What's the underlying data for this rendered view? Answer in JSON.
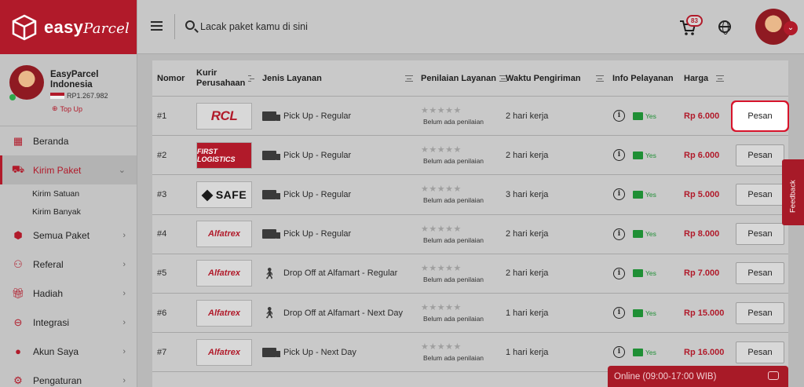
{
  "brand": {
    "name": "easy",
    "name_suffix": "Parcel",
    "color": "#b11a2a"
  },
  "profile": {
    "name": "EasyParcel Indonesia",
    "balance": "RP1.267.982",
    "topup_label": "Top Up",
    "status": "online"
  },
  "sidebar": {
    "items": [
      {
        "label": "Beranda",
        "icon": "home-icon"
      },
      {
        "label": "Kirim Paket",
        "icon": "truck-icon",
        "active": true,
        "sub": [
          {
            "label": "Kirim Satuan"
          },
          {
            "label": "Kirim Banyak"
          }
        ]
      },
      {
        "label": "Semua Paket",
        "icon": "packages-icon"
      },
      {
        "label": "Referal",
        "icon": "referral-icon"
      },
      {
        "label": "Hadiah",
        "icon": "gift-icon"
      },
      {
        "label": "Integrasi",
        "icon": "link-icon"
      },
      {
        "label": "Akun Saya",
        "icon": "user-icon"
      },
      {
        "label": "Pengaturan",
        "icon": "settings-icon"
      }
    ]
  },
  "search": {
    "placeholder": "Lacak paket kamu di sini"
  },
  "cart": {
    "count": "83"
  },
  "table": {
    "headers": {
      "nomor": "Nomor",
      "kurir": "Kurir Perusahaan",
      "jenis": "Jenis Layanan",
      "penilaian": "Penilaian Layanan",
      "waktu": "Waktu Pengiriman",
      "info": "Info Pelayanan",
      "harga": "Harga"
    },
    "rows": [
      {
        "no": "#1",
        "courier": "RCL",
        "service": "Pick Up - Regular",
        "service_icon": "truck-icon",
        "rating": "Belum ada penilaian",
        "time": "2 hari kerja",
        "yes": "Yes",
        "price": "Rp 6.000",
        "button": "Pesan"
      },
      {
        "no": "#2",
        "courier": "FIRST LOGISTICS",
        "service": "Pick Up - Regular",
        "service_icon": "truck-icon",
        "rating": "Belum ada penilaian",
        "time": "2 hari kerja",
        "yes": "Yes",
        "price": "Rp 6.000",
        "button": "Pesan"
      },
      {
        "no": "#3",
        "courier": "SAFE",
        "service": "Pick Up - Regular",
        "service_icon": "truck-icon",
        "rating": "Belum ada penilaian",
        "time": "3 hari kerja",
        "yes": "Yes",
        "price": "Rp 5.000",
        "button": "Pesan"
      },
      {
        "no": "#4",
        "courier": "Alfatrex",
        "service": "Pick Up - Regular",
        "service_icon": "truck-icon",
        "rating": "Belum ada penilaian",
        "time": "2 hari kerja",
        "yes": "Yes",
        "price": "Rp 8.000",
        "button": "Pesan"
      },
      {
        "no": "#5",
        "courier": "Alfatrex",
        "service": "Drop Off at Alfamart - Regular",
        "service_icon": "walk-icon",
        "rating": "Belum ada penilaian",
        "time": "2 hari kerja",
        "yes": "Yes",
        "price": "Rp 7.000",
        "button": "Pesan"
      },
      {
        "no": "#6",
        "courier": "Alfatrex",
        "service": "Drop Off at Alfamart - Next Day",
        "service_icon": "walk-icon",
        "rating": "Belum ada penilaian",
        "time": "1 hari kerja",
        "yes": "Yes",
        "price": "Rp 15.000",
        "button": "Pesan"
      },
      {
        "no": "#7",
        "courier": "Alfatrex",
        "service": "Pick Up - Next Day",
        "service_icon": "truck-icon",
        "rating": "Belum ada penilaian",
        "time": "1 hari kerja",
        "yes": "Yes",
        "price": "Rp 16.000",
        "button": "Pesan"
      }
    ]
  },
  "feedback": {
    "label": "Feedback"
  },
  "chat": {
    "label": "Online (09:00-17:00 WIB)"
  }
}
